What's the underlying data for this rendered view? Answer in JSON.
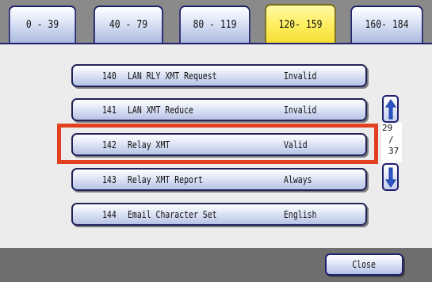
{
  "tabs": [
    {
      "label": "0 - 39",
      "active": false
    },
    {
      "label": "40 - 79",
      "active": false
    },
    {
      "label": "80 - 119",
      "active": false
    },
    {
      "label": "120- 159",
      "active": true
    },
    {
      "label": "160- 184",
      "active": false
    }
  ],
  "items": [
    {
      "number": "140",
      "label": "LAN RLY XMT Request",
      "value": "Invalid",
      "selected": false
    },
    {
      "number": "141",
      "label": "LAN XMT Reduce",
      "value": "Invalid",
      "selected": false
    },
    {
      "number": "142",
      "label": "Relay XMT",
      "value": "Valid",
      "selected": true
    },
    {
      "number": "143",
      "label": "Relay XMT Report",
      "value": "Always",
      "selected": false
    },
    {
      "number": "144",
      "label": "Email Character Set",
      "value": "English",
      "selected": false
    }
  ],
  "pagination": {
    "current": "29",
    "separator": "/",
    "total": "37"
  },
  "footer": {
    "close_label": "Close"
  },
  "colors": {
    "highlight": "#e2401f",
    "active_tab": "#fff066",
    "button_border": "#1f1f6e"
  }
}
